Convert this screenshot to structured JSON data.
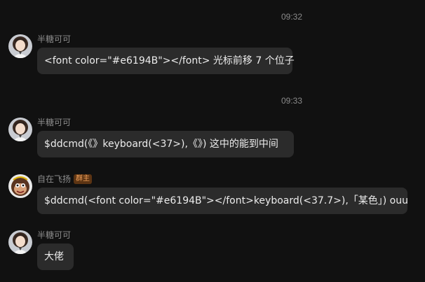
{
  "colors": {
    "background": "#111111",
    "bubble": "#2b2b2b",
    "badge_bg": "#5c3413",
    "badge_text": "#f3a35c"
  },
  "timestamps": [
    "09:32",
    "09:33"
  ],
  "messages": [
    {
      "sender": "半糖可可",
      "avatar": "girl-avatar",
      "text": "<font color=\"#e6194B\"></font>  光标前移 7 个位子"
    },
    {
      "sender": "半糖可可",
      "avatar": "girl-avatar",
      "text": "$ddcmd(《》keyboard(<37>),《》)   这中的能到中间"
    },
    {
      "sender": "自在飞扬",
      "badge": "群主",
      "avatar": "monkey-avatar",
      "text": "$ddcmd(<font color=\"#e6194B\"></font>keyboard(<37.7>),「某色」)   ouu"
    },
    {
      "sender": "半糖可可",
      "avatar": "girl-avatar",
      "text": "大佬"
    }
  ]
}
